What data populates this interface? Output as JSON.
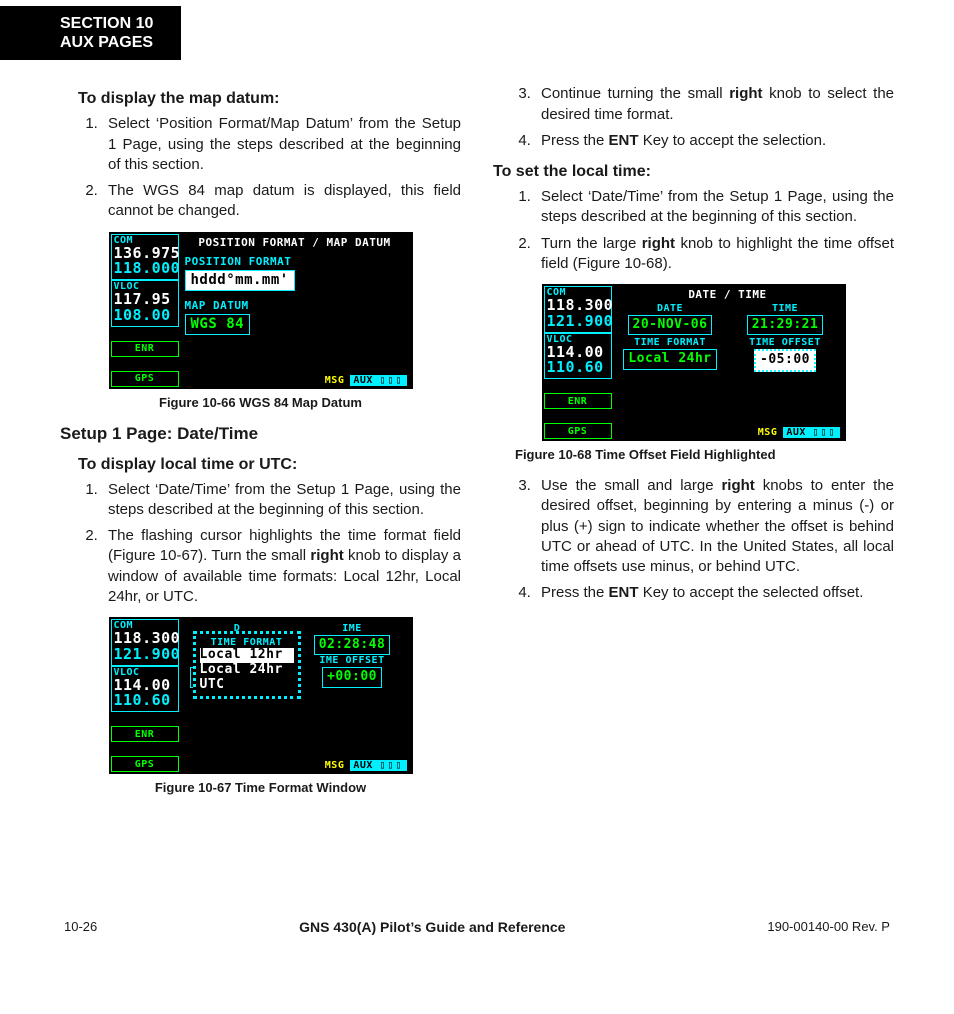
{
  "header": {
    "line1": "SECTION 10",
    "line2": "AUX PAGES"
  },
  "left": {
    "h4_1": "To display the map datum:",
    "steps1": [
      "Select ‘Position Format/Map Datum’ from the Setup 1 Page, using the steps described at the beginning of this section.",
      "The WGS 84 map datum is displayed, this field cannot be changed."
    ],
    "fig66_caption": "Figure 10-66  WGS 84 Map Datum",
    "h3": "Setup 1 Page: Date/Time",
    "h4_2": "To display local time or UTC:",
    "steps2": [
      "Select ‘Date/Time’ from the Setup 1 Page, using the steps described at the beginning of this section.",
      [
        "The flashing cursor highlights the time format field (Figure 10-67).  Turn the small ",
        "right",
        " knob to display a window of available time formats: Local 12hr, Local 24hr, or UTC."
      ]
    ],
    "fig67_caption": "Figure 10-67  Time Format Window"
  },
  "right": {
    "steps_contA": [
      [
        "Continue turning the small ",
        "right",
        " knob to select the desired time format."
      ],
      [
        "Press the ",
        "ENT",
        " Key to accept the selection."
      ]
    ],
    "h4_1": "To set the local time:",
    "steps1": [
      "Select ‘Date/Time’ from the Setup 1 Page, using the steps described at the beginning of this section.",
      [
        "Turn the large ",
        "right",
        " knob to highlight the time offset field (Figure 10-68)."
      ]
    ],
    "fig68_caption": "Figure 10-68  Time Offset Field Highlighted",
    "steps2": [
      [
        "Use the small and large ",
        "right",
        " knobs to enter the desired offset, beginning by entering a minus (-) or plus (+) sign to indicate whether the offset is behind UTC or ahead of UTC.  In the United States, all local time offsets use minus, or behind UTC."
      ],
      [
        "Press the ",
        "ENT",
        " Key to accept the selected offset."
      ]
    ]
  },
  "fig66": {
    "title": "POSITION FORMAT / MAP DATUM",
    "com1": "136.975",
    "com2": "118.000",
    "vloc1": "117.95",
    "vloc2": "108.00",
    "pf_label": "POSITION FORMAT",
    "pf": "hddd°mm.mm'",
    "md_label": "MAP DATUM",
    "md": "WGS 84",
    "enr": "ENR",
    "gps": "GPS",
    "msg": "MSG",
    "aux": "AUX"
  },
  "fig67": {
    "title": "TIME FORMAT",
    "com1": "118.300",
    "com2": "121.900",
    "vloc1": "114.00",
    "vloc2": "110.60",
    "time": "02:28:48",
    "tf_curr": "Local 24hr",
    "offset": "+00:00",
    "opts": [
      "Local 12hr",
      "Local 24hr",
      "UTC"
    ],
    "sel": 0,
    "dlabel": "D",
    "ilabel_t": "IME",
    "ilabel_o": "IME OFFSET",
    "enr": "ENR",
    "gps": "GPS",
    "msg": "MSG",
    "aux": "AUX"
  },
  "fig68": {
    "title": "DATE / TIME",
    "com1": "118.300",
    "com2": "121.900",
    "vloc1": "114.00",
    "vloc2": "110.60",
    "date_l": "DATE",
    "date": "20-NOV-06",
    "time_l": "TIME",
    "time": "21:29:21",
    "tf_l": "TIME FORMAT",
    "tf": "Local 24hr",
    "to_l": "TIME OFFSET",
    "to": "-05:00",
    "enr": "ENR",
    "gps": "GPS",
    "msg": "MSG",
    "aux": "AUX"
  },
  "footer": {
    "page": "10-26",
    "title": "GNS 430(A) Pilot’s Guide and Reference",
    "rev": "190-00140-00  Rev. P"
  },
  "labels": {
    "com": "COM",
    "vloc": "VLOC"
  }
}
